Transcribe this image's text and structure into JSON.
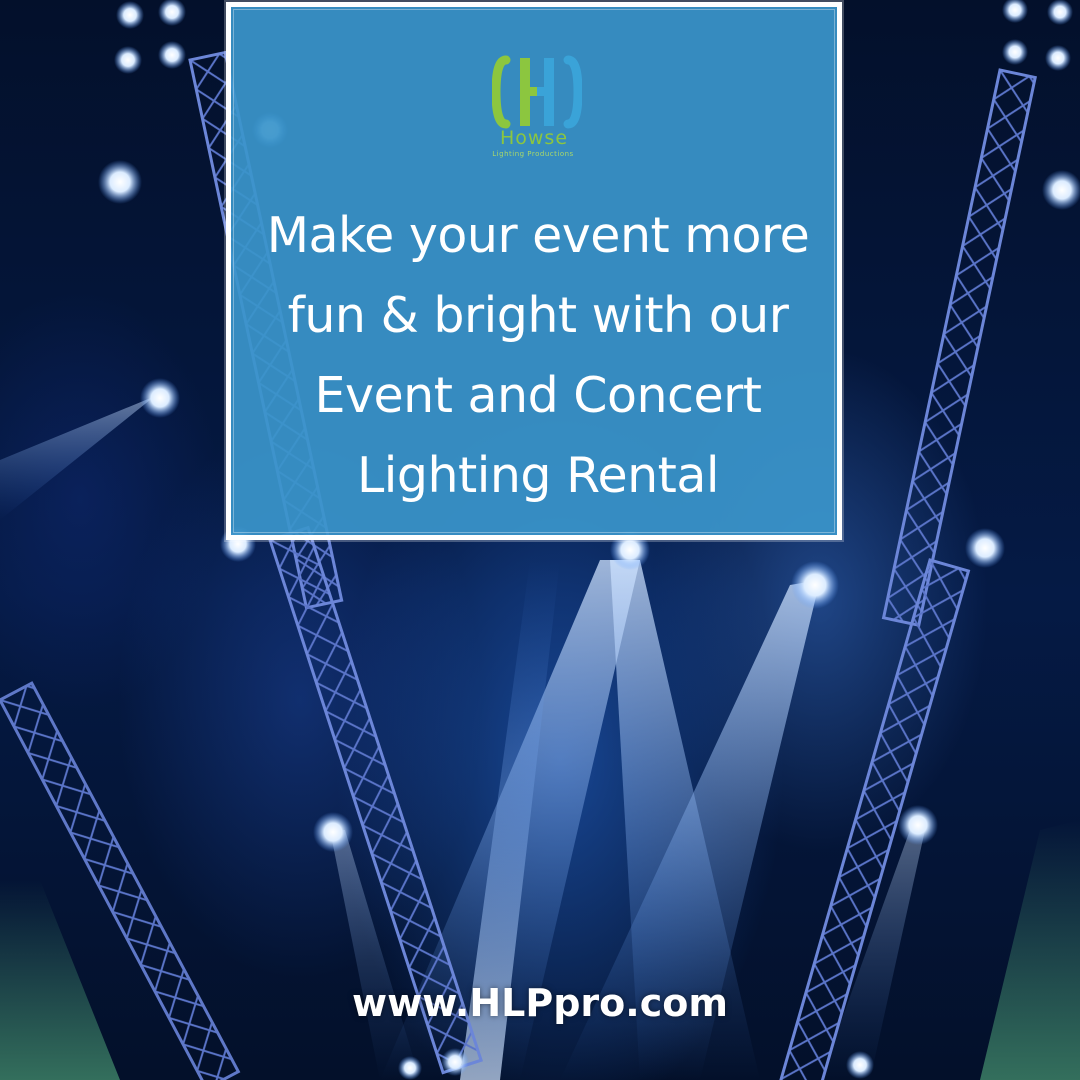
{
  "brand": {
    "monogram": "H",
    "name": "Howse",
    "tagline": "Lighting Productions",
    "logo_colors": {
      "green": "#8cc63f",
      "blue": "#3aa3d8"
    }
  },
  "headline": {
    "lines": [
      "Make your event more",
      "fun & bright with our",
      "Event and Concert",
      "Lighting Rental"
    ]
  },
  "footer": {
    "website": "www.HLPpro.com"
  },
  "colors": {
    "card_fill": "#3a94ca",
    "card_border": "#ffffff",
    "background": "#03102b",
    "beam": "#9cc8ff"
  }
}
